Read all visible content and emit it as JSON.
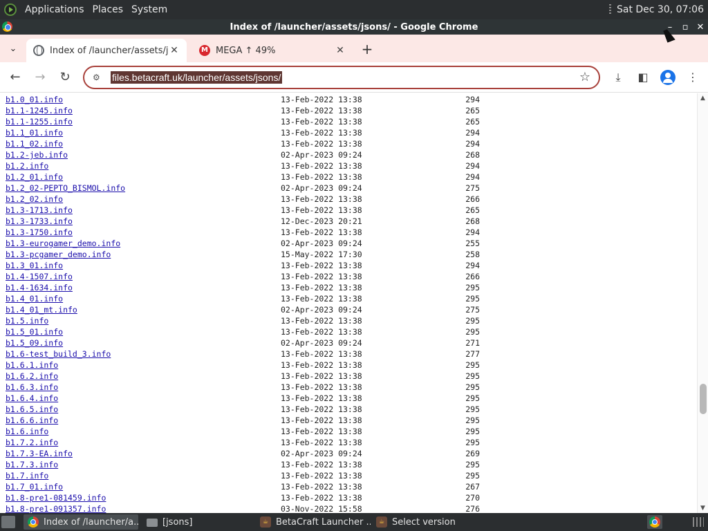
{
  "top_panel": {
    "menus": [
      "Applications",
      "Places",
      "System"
    ],
    "clock": "Sat Dec 30, 07:06"
  },
  "window": {
    "title": "Index of /launcher/assets/jsons/ - Google Chrome"
  },
  "tabs": [
    {
      "title": "Index of /launcher/assets/jsons/",
      "active": true
    },
    {
      "title": "MEGA ↑ 49%",
      "active": false
    }
  ],
  "toolbar": {
    "url": "files.betacraft.uk/launcher/assets/jsons/"
  },
  "listing": [
    {
      "name": "b1.0_01.info",
      "date": "13-Feb-2022 13:38",
      "size": "294"
    },
    {
      "name": "b1.1-1245.info",
      "date": "13-Feb-2022 13:38",
      "size": "265"
    },
    {
      "name": "b1.1-1255.info",
      "date": "13-Feb-2022 13:38",
      "size": "265"
    },
    {
      "name": "b1.1_01.info",
      "date": "13-Feb-2022 13:38",
      "size": "294"
    },
    {
      "name": "b1.1_02.info",
      "date": "13-Feb-2022 13:38",
      "size": "294"
    },
    {
      "name": "b1.2-jeb.info",
      "date": "02-Apr-2023 09:24",
      "size": "268"
    },
    {
      "name": "b1.2.info",
      "date": "13-Feb-2022 13:38",
      "size": "294"
    },
    {
      "name": "b1.2_01.info",
      "date": "13-Feb-2022 13:38",
      "size": "294"
    },
    {
      "name": "b1.2_02-PEPTO_BISMOL.info",
      "date": "02-Apr-2023 09:24",
      "size": "275"
    },
    {
      "name": "b1.2_02.info",
      "date": "13-Feb-2022 13:38",
      "size": "266"
    },
    {
      "name": "b1.3-1713.info",
      "date": "13-Feb-2022 13:38",
      "size": "265"
    },
    {
      "name": "b1.3-1733.info",
      "date": "12-Dec-2023 20:21",
      "size": "268"
    },
    {
      "name": "b1.3-1750.info",
      "date": "13-Feb-2022 13:38",
      "size": "294"
    },
    {
      "name": "b1.3-eurogamer_demo.info",
      "date": "02-Apr-2023 09:24",
      "size": "255"
    },
    {
      "name": "b1.3-pcgamer_demo.info",
      "date": "15-May-2022 17:30",
      "size": "258"
    },
    {
      "name": "b1.3_01.info",
      "date": "13-Feb-2022 13:38",
      "size": "294"
    },
    {
      "name": "b1.4-1507.info",
      "date": "13-Feb-2022 13:38",
      "size": "266"
    },
    {
      "name": "b1.4-1634.info",
      "date": "13-Feb-2022 13:38",
      "size": "295"
    },
    {
      "name": "b1.4_01.info",
      "date": "13-Feb-2022 13:38",
      "size": "295"
    },
    {
      "name": "b1.4_01_mt.info",
      "date": "02-Apr-2023 09:24",
      "size": "275"
    },
    {
      "name": "b1.5.info",
      "date": "13-Feb-2022 13:38",
      "size": "295"
    },
    {
      "name": "b1.5_01.info",
      "date": "13-Feb-2022 13:38",
      "size": "295"
    },
    {
      "name": "b1.5_09.info",
      "date": "02-Apr-2023 09:24",
      "size": "271"
    },
    {
      "name": "b1.6-test_build_3.info",
      "date": "13-Feb-2022 13:38",
      "size": "277"
    },
    {
      "name": "b1.6.1.info",
      "date": "13-Feb-2022 13:38",
      "size": "295"
    },
    {
      "name": "b1.6.2.info",
      "date": "13-Feb-2022 13:38",
      "size": "295"
    },
    {
      "name": "b1.6.3.info",
      "date": "13-Feb-2022 13:38",
      "size": "295"
    },
    {
      "name": "b1.6.4.info",
      "date": "13-Feb-2022 13:38",
      "size": "295"
    },
    {
      "name": "b1.6.5.info",
      "date": "13-Feb-2022 13:38",
      "size": "295"
    },
    {
      "name": "b1.6.6.info",
      "date": "13-Feb-2022 13:38",
      "size": "295"
    },
    {
      "name": "b1.6.info",
      "date": "13-Feb-2022 13:38",
      "size": "295"
    },
    {
      "name": "b1.7.2.info",
      "date": "13-Feb-2022 13:38",
      "size": "295"
    },
    {
      "name": "b1.7.3-EA.info",
      "date": "02-Apr-2023 09:24",
      "size": "269"
    },
    {
      "name": "b1.7.3.info",
      "date": "13-Feb-2022 13:38",
      "size": "295"
    },
    {
      "name": "b1.7.info",
      "date": "13-Feb-2022 13:38",
      "size": "295"
    },
    {
      "name": "b1.7_01.info",
      "date": "13-Feb-2022 13:38",
      "size": "267"
    },
    {
      "name": "b1.8-pre1-081459.info",
      "date": "13-Feb-2022 13:38",
      "size": "270"
    },
    {
      "name": "b1.8-pre1-091357.info",
      "date": "03-Nov-2022 15:58",
      "size": "276"
    }
  ],
  "taskbar": {
    "items": [
      {
        "label": "Index of /launcher/a...",
        "icon": "chrome-icon",
        "active": true
      },
      {
        "label": "[jsons]",
        "icon": "folder-icon",
        "active": false
      },
      {
        "label": "BetaCraft Launcher ...",
        "icon": "java-icon",
        "active": false
      },
      {
        "label": "Select version",
        "icon": "java-icon",
        "active": false
      }
    ]
  },
  "colors": {
    "link": "#1a0dab",
    "tabstrip": "#fce8e6",
    "panel": "#2b2e30",
    "omnibox_border": "#a8403a"
  }
}
